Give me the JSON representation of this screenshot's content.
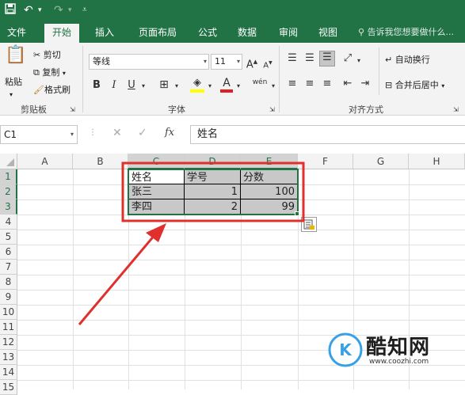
{
  "quick_access": {
    "save_icon": "save-icon",
    "undo_icon": "undo-icon",
    "redo_icon": "redo-icon",
    "customize_icon": "customize-icon"
  },
  "tabs": [
    {
      "label": "文件"
    },
    {
      "label": "开始"
    },
    {
      "label": "插入"
    },
    {
      "label": "页面布局"
    },
    {
      "label": "公式"
    },
    {
      "label": "数据"
    },
    {
      "label": "审阅"
    },
    {
      "label": "视图"
    }
  ],
  "tell_me": "告诉我您想要做什么...",
  "clipboard": {
    "paste": "粘贴",
    "cut": "剪切",
    "copy": "复制",
    "format_painter": "格式刷",
    "group_label": "剪贴板"
  },
  "font": {
    "name": "等线",
    "size": "11",
    "bold": "B",
    "italic": "I",
    "underline": "U",
    "grow": "A",
    "shrink": "A",
    "color_letter": "A",
    "phonetic": "wén",
    "group_label": "字体"
  },
  "alignment": {
    "wrap": "自动换行",
    "merge": "合并后居中",
    "group_label": "对齐方式"
  },
  "formula_bar": {
    "name_box": "C1",
    "content": "姓名",
    "fx": "fx"
  },
  "columns": [
    "A",
    "B",
    "C",
    "D",
    "E",
    "F",
    "G",
    "H"
  ],
  "rows": [
    "1",
    "2",
    "3",
    "4",
    "5",
    "6",
    "7",
    "8",
    "9",
    "10",
    "11",
    "12",
    "13",
    "14",
    "15"
  ],
  "table": {
    "headers": [
      "姓名",
      "学号",
      "分数"
    ],
    "rows": [
      [
        "张三",
        "1",
        "100"
      ],
      [
        "李四",
        "2",
        "99"
      ]
    ]
  },
  "watermark": {
    "brand": "酷知网",
    "url": "www.coozhi.com"
  },
  "accent_color": "#217346",
  "annotation_color": "#e0302d"
}
